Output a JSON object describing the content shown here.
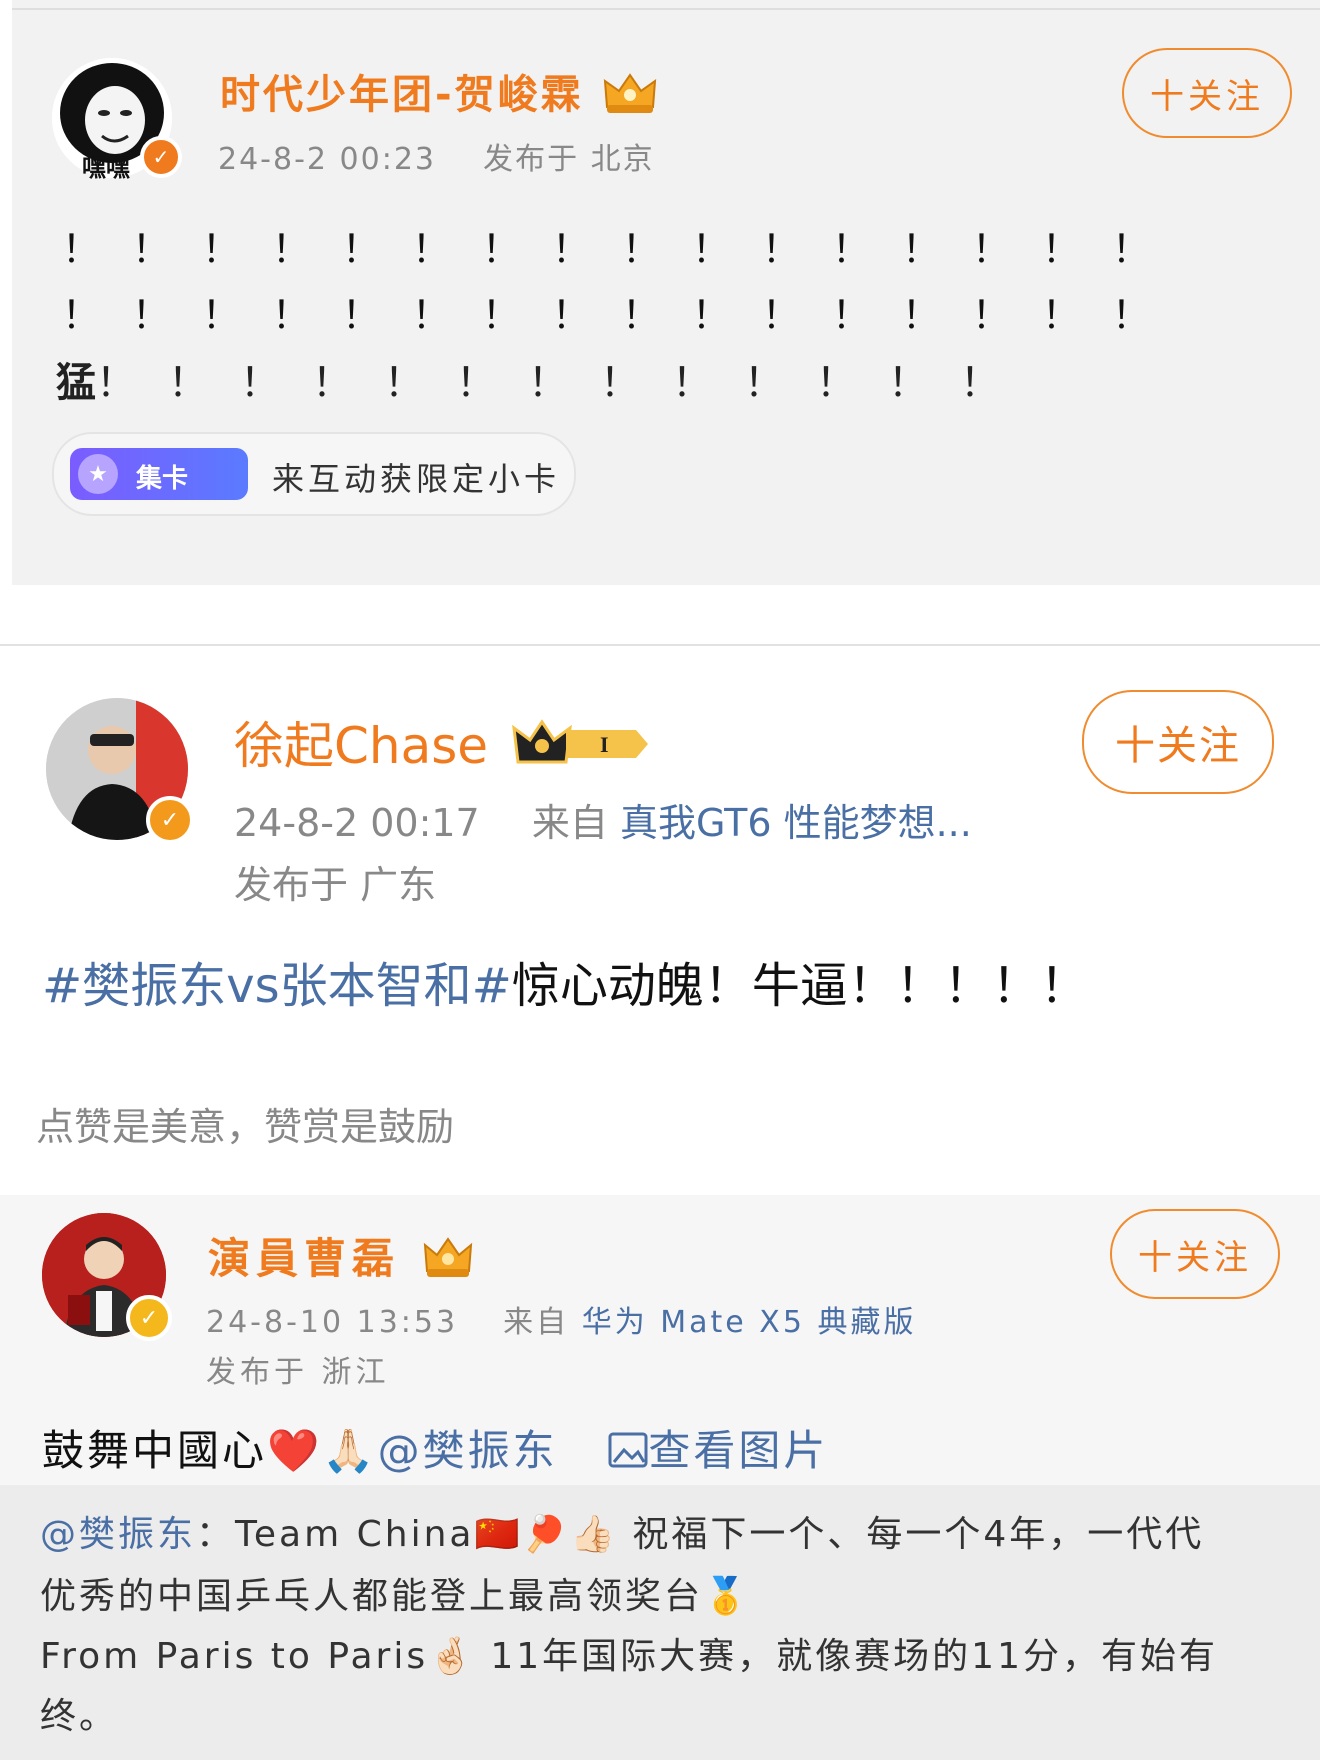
{
  "post1": {
    "author": "时代少年团-贺峻霖",
    "avatar_text": "嘿嘿",
    "crown_icon": "crown-icon",
    "time": "24-8-2 00:23",
    "location": "发布于 北京",
    "follow_label": "十关注",
    "line1": "！！！！！！！！！！！！！！！！",
    "line2": "！！！！！！！！！！！！！！！！",
    "line3_prefix": "猛",
    "line3": "！！！！！！！！！！！！！",
    "card_tag": "集卡",
    "card_text": "来互动获限定小卡"
  },
  "post2": {
    "author": "徐起Chase",
    "level": "I",
    "time": "24-8-2 00:17",
    "source_prefix": "来自",
    "source": "真我GT6 性能梦想...",
    "location": "发布于 广东",
    "follow_label": "十关注",
    "hashtag": "#樊振东vs张本智和#",
    "content": "惊心动魄！牛逼！！！！！",
    "reward_text": "点赞是美意，赞赏是鼓励"
  },
  "post3": {
    "author": "演員曹磊",
    "time": "24-8-10 13:53",
    "source_prefix": "来自",
    "source": "华为 Mate X5 典藏版",
    "location": "发布于 浙江",
    "follow_label": "十关注",
    "content_text": "鼓舞中國心❤️🙏🏻",
    "mention": "@樊振东",
    "view_image": "查看图片",
    "quote_mention": "@樊振东",
    "quote_line1": "：Team China🇨🇳🏓👍🏻 祝福下一个、每一个4年，一代代",
    "quote_line2": "优秀的中国乒乓人都能登上最高领奖台🥇",
    "quote_line3": "From Paris to Paris🤞🏻 11年国际大赛，就像赛场的11分，有始有",
    "quote_line4": "终。"
  },
  "colors": {
    "name_orange": "#f07a1e",
    "link_blue": "#4a6fa5",
    "meta_gray": "#888888",
    "verified_orange": "#f39a1c",
    "verified_yellow": "#f5b81c"
  }
}
